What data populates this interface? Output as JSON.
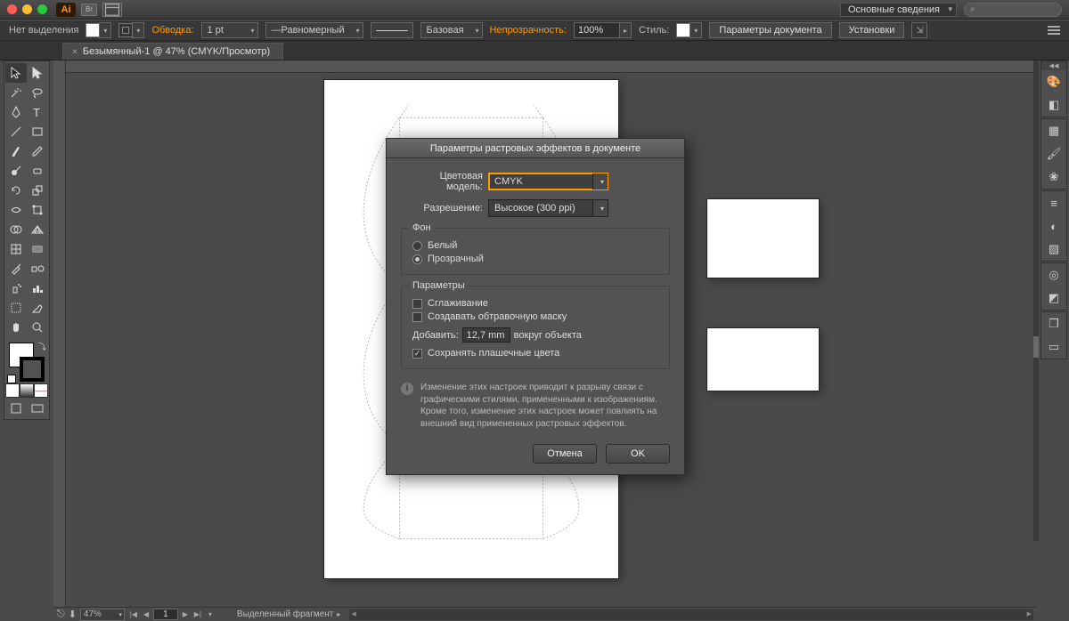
{
  "titlebar": {
    "ai": "Ai",
    "br": "Br",
    "workspace": "Основные сведения",
    "search_placeholder": "⌕"
  },
  "controlbar": {
    "no_selection": "Нет выделения",
    "stroke_label": "Обводка:",
    "stroke_width": "1 pt",
    "uniform": "Равномерный",
    "basic": "Базовая",
    "opacity_label": "Непрозрачность:",
    "opacity_value": "100%",
    "style_label": "Стиль:",
    "doc_params_btn": "Параметры документа",
    "prefs_btn": "Установки"
  },
  "tab": {
    "label": "Безымянный-1 @ 47% (CMYK/Просмотр)"
  },
  "status": {
    "zoom": "47%",
    "page": "1",
    "info": "Выделенный фрагмент"
  },
  "dialog": {
    "title": "Параметры растровых эффектов в документе",
    "color_model_label": "Цветовая модель:",
    "color_model_value": "CMYK",
    "resolution_label": "Разрешение:",
    "resolution_value": "Высокое (300 ppi)",
    "bg_legend": "Фон",
    "bg_white": "Белый",
    "bg_transparent": "Прозрачный",
    "params_legend": "Параметры",
    "antialias": "Сглаживание",
    "clip_mask": "Создавать обтравочную маску",
    "add_label": "Добавить:",
    "add_value": "12,7 mm",
    "add_suffix": "вокруг объекта",
    "preserve_spot": "Сохранять плашечные цвета",
    "info_text": "Изменение этих настроек приводит к разрыву связи с графическими стилями, примененными к изображениям. Кроме того, изменение этих настроек может повлиять на внешний вид примененных растровых эффектов.",
    "cancel": "Отмена",
    "ok": "OK"
  }
}
